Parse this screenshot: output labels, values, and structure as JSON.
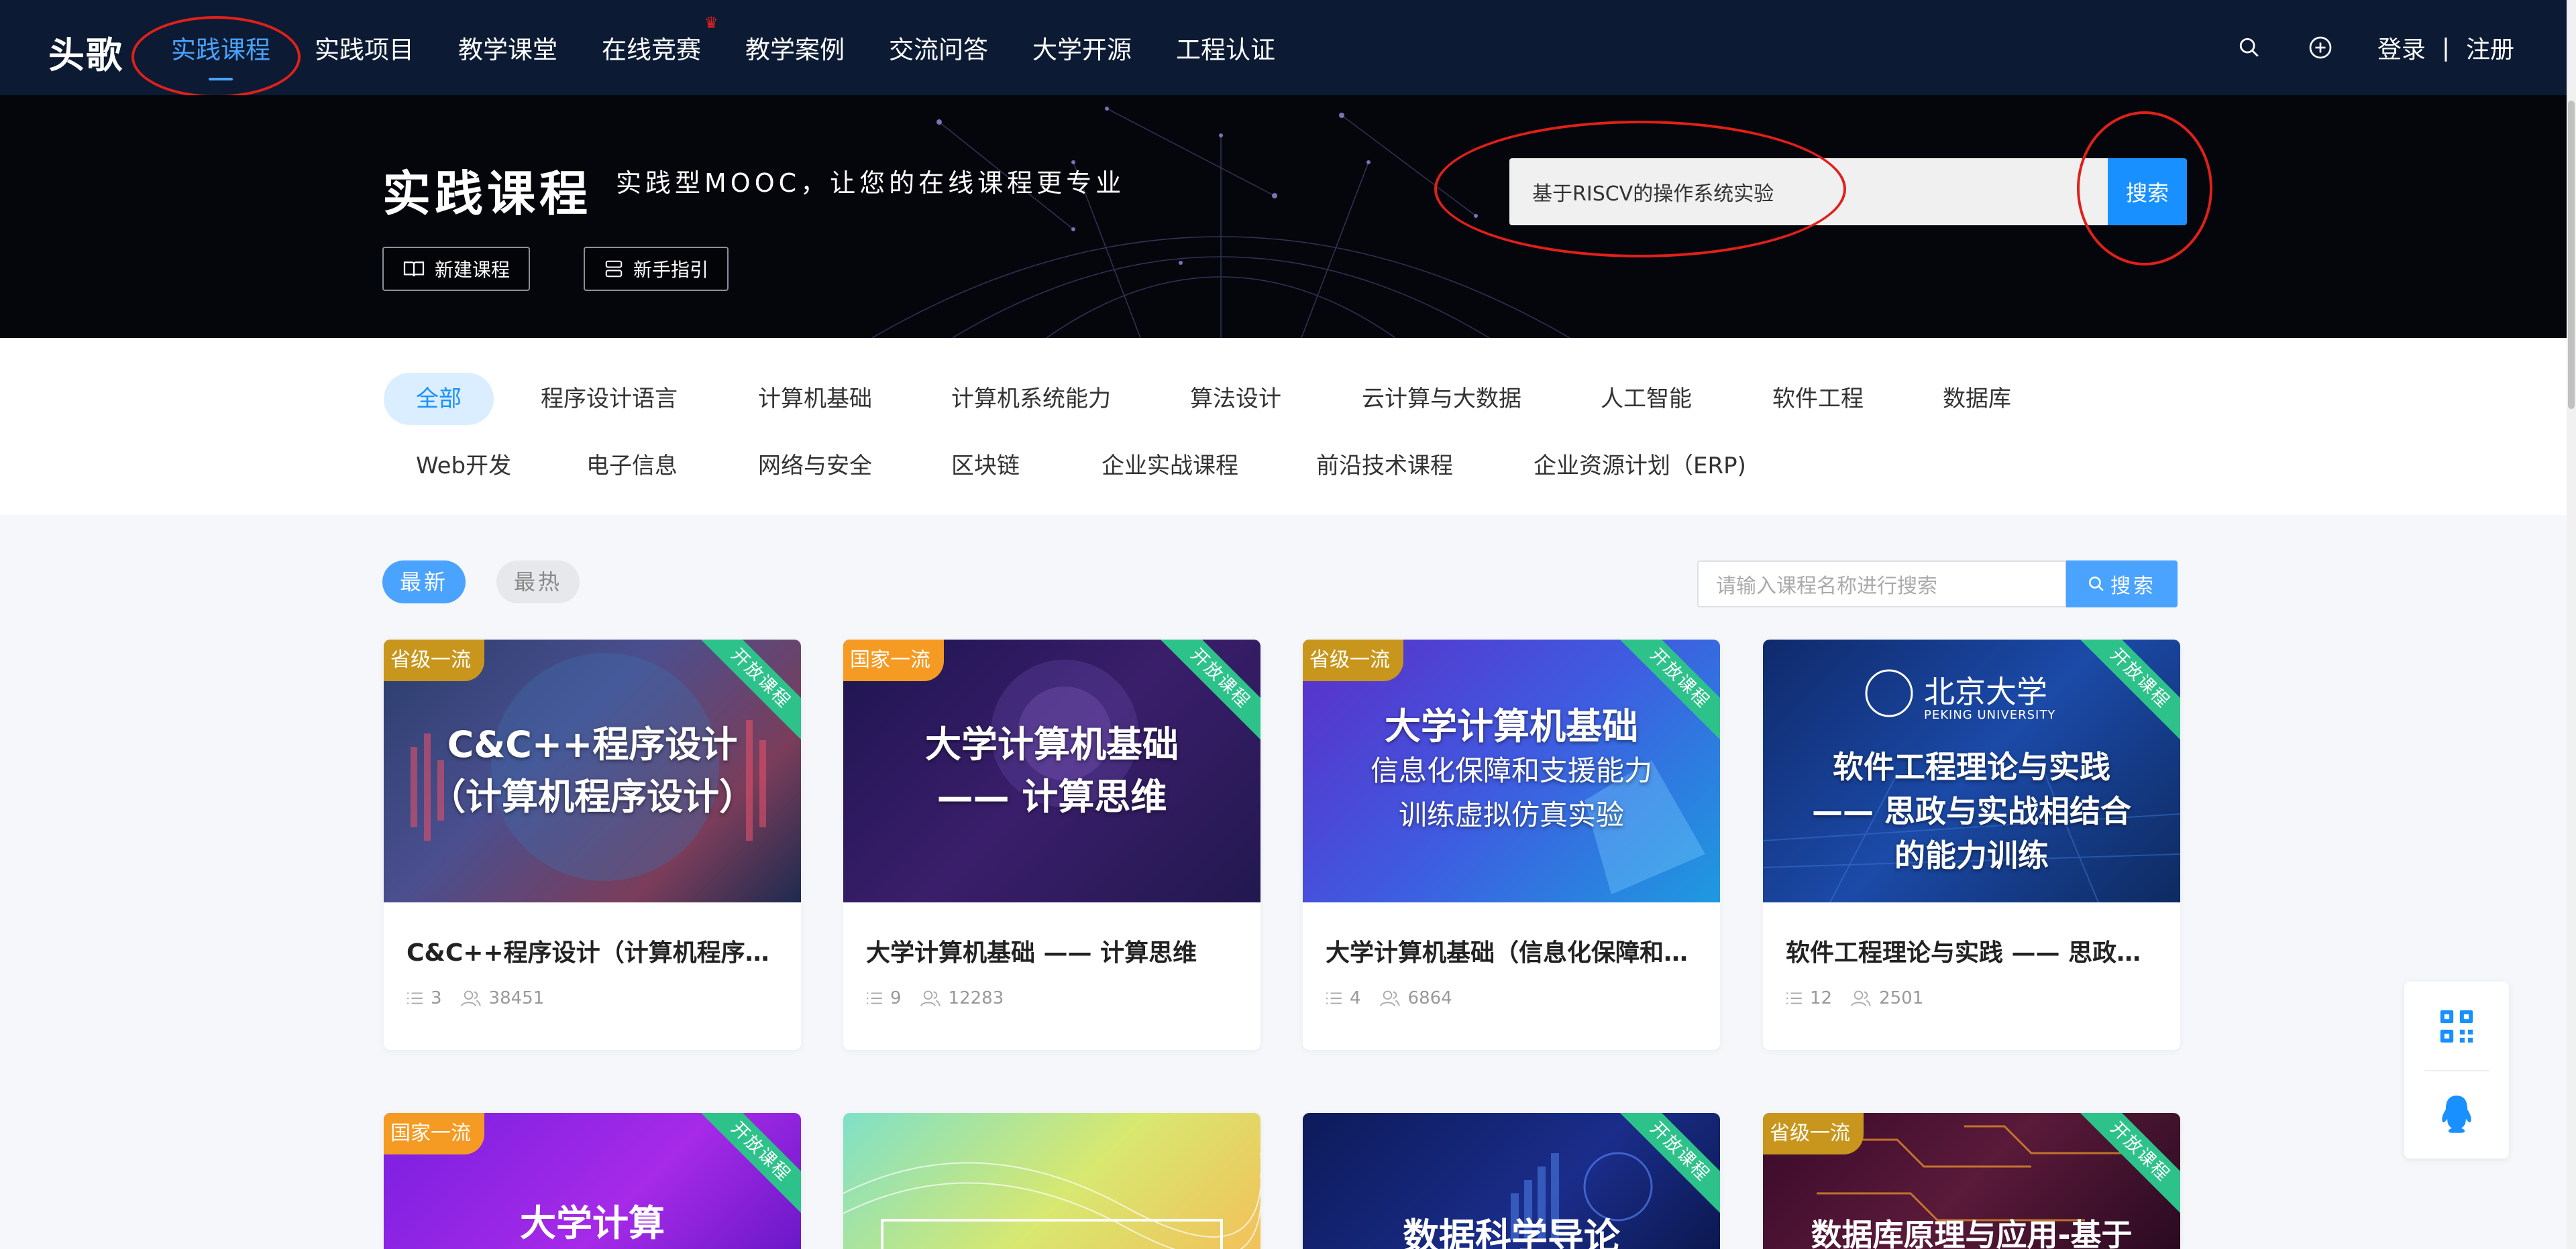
{
  "nav": {
    "logo": "头歌",
    "items": [
      "实践课程",
      "实践项目",
      "教学课堂",
      "在线竞赛",
      "教学案例",
      "交流问答",
      "大学开源",
      "工程认证"
    ],
    "login": "登录",
    "separator": "|",
    "register": "注册"
  },
  "hero": {
    "title": "实践课程",
    "subtitle": "实践型MOOC，让您的在线课程更专业",
    "new_course": "新建课程",
    "guide": "新手指引",
    "search_value": "基于RISCV的操作系统实验",
    "search_button": "搜索"
  },
  "categories": {
    "row1": [
      "全部",
      "程序设计语言",
      "计算机基础",
      "计算机系统能力",
      "算法设计",
      "云计算与大数据",
      "人工智能",
      "软件工程",
      "数据库"
    ],
    "row2": [
      "Web开发",
      "电子信息",
      "网络与安全",
      "区块链",
      "企业实战课程",
      "前沿技术课程",
      "企业资源计划（ERP)"
    ]
  },
  "sort": {
    "latest": "最新",
    "hottest": "最热",
    "search_placeholder": "请输入课程名称进行搜索",
    "search_button": "搜索"
  },
  "ribbon_label": "开放课程",
  "cards": [
    {
      "badge": "省级一流",
      "img_l1": "C&C++程序设计",
      "img_l2": "（计算机程序设计）",
      "img_l3": "",
      "title": "C&C++程序设计（计算机程序设计）",
      "chapters": "3",
      "students": "38451"
    },
    {
      "badge": "国家一流",
      "img_l1": "大学计算机基础",
      "img_l2": "—— 计算思维",
      "img_l3": "",
      "title": "大学计算机基础 —— 计算思维",
      "chapters": "9",
      "students": "12283"
    },
    {
      "badge": "省级一流",
      "img_l1": "大学计算机基础",
      "img_l2": "信息化保障和支援能力",
      "img_l3": "训练虚拟仿真实验",
      "title": "大学计算机基础（信息化保障和支援能力训练虚拟仿真实验）",
      "chapters": "4",
      "students": "6864"
    },
    {
      "badge": "",
      "img_top1": "北京大学",
      "img_top2": "PEKING UNIVERSITY",
      "img_l1": "软件工程理论与实践",
      "img_l2": "—— 思政与实战相结合",
      "img_l3": "的能力训练",
      "title": "软件工程理论与实践 —— 思政与实战相结合的能力训练",
      "chapters": "12",
      "students": "2501"
    }
  ],
  "cards_row2": [
    {
      "badge": "国家一流",
      "img_l1": "大学计算"
    },
    {
      "badge": "",
      "img_l1": ""
    },
    {
      "badge": "",
      "img_l1": "数据科学导论"
    },
    {
      "badge": "省级一流",
      "img_l1": "数据库原理与应用-基于"
    }
  ],
  "colors": {
    "nav_bg": "#0c1b33",
    "accent": "#1890ff",
    "ribbon": "#2ec28b",
    "badge_provincial": "#c8961c",
    "badge_national": "#f59a23"
  }
}
